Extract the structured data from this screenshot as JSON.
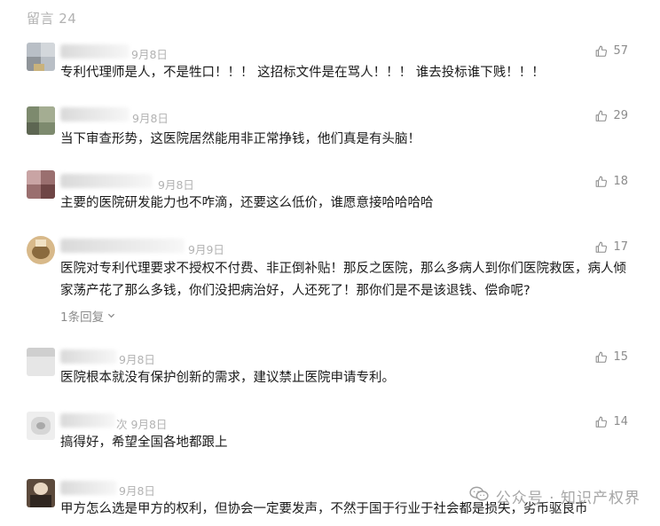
{
  "header": {
    "title": "留言 24"
  },
  "comments": [
    {
      "date": "9月8日",
      "likes": "57",
      "text": "专利代理师是人，不是牲口！！！ 这招标文件是在骂人！！！ 谁去投标谁下贱！！！"
    },
    {
      "date": "9月8日",
      "likes": "29",
      "text": "当下审查形势，这医院居然能用非正常挣钱，他们真是有头脑！"
    },
    {
      "date": "9月8日",
      "likes": "18",
      "text": "主要的医院研发能力也不咋滴，还要这么低价，谁愿意接哈哈哈哈"
    },
    {
      "date": "9月9日",
      "likes": "17",
      "text": "医院对专利代理要求不授权不付费、非正倒补贴！那反之医院，那么多病人到你们医院救医，病人倾家荡产花了那么多钱，你们没把病治好，人还死了！那你们是不是该退钱、偿命呢?",
      "reply": "1条回复"
    },
    {
      "date": "9月8日",
      "likes": "15",
      "text": "医院根本就没有保护创新的需求，建议禁止医院申请专利。"
    },
    {
      "date": "9月8日",
      "likes": "14",
      "text": "搞得好，希望全国各地都跟上",
      "name_suffix": "次"
    },
    {
      "date": "9月8日",
      "likes": "",
      "text": "甲方怎么选是甲方的权利，但协会一定要发声，不然于国于行业于社会都是损失，劣币驱良币"
    }
  ],
  "watermark": {
    "text": "公众号 · 知识产权界"
  },
  "colors": {
    "text": "#1a1a1a",
    "meta": "#b2b2b2",
    "like": "#8c8c8c"
  },
  "icons": {
    "like": "thumbs-up-icon",
    "expand": "chevron-down-icon",
    "wechat": "wechat-logo-icon"
  }
}
